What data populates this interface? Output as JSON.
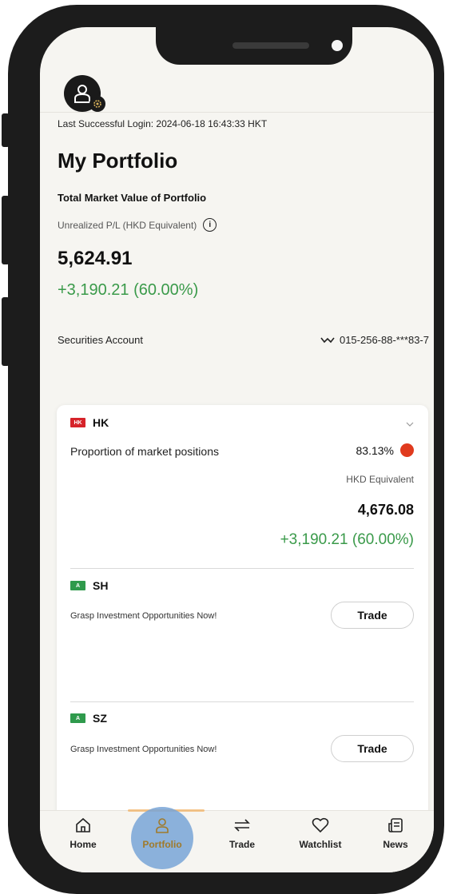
{
  "header": {
    "last_login": "Last Successful Login: 2024-06-18 16:43:33 HKT",
    "page_title": "My Portfolio"
  },
  "portfolio": {
    "total_market_value_label": "Total Market Value of Portfolio",
    "unrealized_pl_label": "Unrealized P/L (HKD Equivalent)",
    "total_value": "5,624.91",
    "total_gain": "+3,190.21 (60.00%)",
    "account_label": "Securities Account",
    "account_number": "015-256-88-***83-7"
  },
  "markets": [
    {
      "flag": "HK",
      "name": "HK",
      "proportion_label": "Proportion of market positions",
      "proportion_value": "83.13%",
      "currency_label": "HKD Equivalent",
      "value": "4,676.08",
      "gain": "+3,190.21 (60.00%)"
    },
    {
      "flag": "A",
      "name": "SH",
      "promo": "Grasp Investment Opportunities Now!",
      "button": "Trade"
    },
    {
      "flag": "A",
      "name": "SZ",
      "promo": "Grasp Investment Opportunities Now!",
      "button": "Trade"
    }
  ],
  "nav": [
    {
      "label": "Home",
      "icon": "home-icon"
    },
    {
      "label": "Portfolio",
      "icon": "person-icon",
      "active": true
    },
    {
      "label": "Trade",
      "icon": "swap-arrows-icon"
    },
    {
      "label": "Watchlist",
      "icon": "heart-icon"
    },
    {
      "label": "News",
      "icon": "news-icon"
    }
  ],
  "colors": {
    "gain_green": "#3a9a4a",
    "hk_flag_red": "#d6232a",
    "a_flag_green": "#2f9a4c",
    "proportion_dot": "#e03a1e",
    "active_nav": "#a07a2a",
    "tap_highlight": "#78a5d7"
  }
}
